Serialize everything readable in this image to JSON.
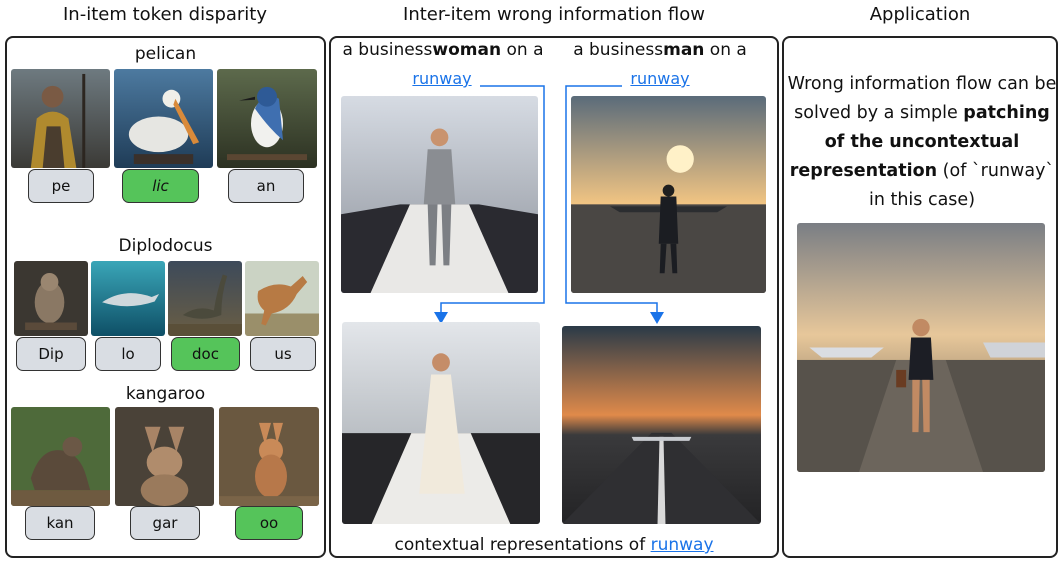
{
  "titles": {
    "left": "In-item token disparity",
    "middle": "Inter-item wrong information flow",
    "right": "Application"
  },
  "left": {
    "groups": [
      {
        "word": "pelican",
        "tokens": [
          {
            "text": "pe",
            "highlight": false
          },
          {
            "text": "lic",
            "highlight": true
          },
          {
            "text": "an",
            "highlight": false
          }
        ]
      },
      {
        "word": "Diplodocus",
        "tokens": [
          {
            "text": "Dip",
            "highlight": false
          },
          {
            "text": "lo",
            "highlight": false
          },
          {
            "text": "doc",
            "highlight": true
          },
          {
            "text": "us",
            "highlight": false
          }
        ]
      },
      {
        "word": "kangaroo",
        "tokens": [
          {
            "text": "kan",
            "highlight": false
          },
          {
            "text": "gar",
            "highlight": false
          },
          {
            "text": "oo",
            "highlight": true
          }
        ]
      }
    ]
  },
  "middle": {
    "prompt_left": {
      "prefix": "a business",
      "bold": "woman",
      "suffix": " on a"
    },
    "prompt_right": {
      "prefix": "a business",
      "bold": "man",
      "suffix": " on a"
    },
    "runway_link": "runway",
    "bottom_caption": "contextual representations of ",
    "bottom_link": "runway"
  },
  "right": {
    "text_1": "Wrong information flow can be solved by a simple ",
    "text_bold": "patching of the uncontextual representation",
    "text_2": " (of `runway` in this case)"
  },
  "colors": {
    "highlight_token": "#55c45a",
    "token": "#d9dde3",
    "link": "#1a73e8",
    "arrow": "#1a73e8"
  }
}
